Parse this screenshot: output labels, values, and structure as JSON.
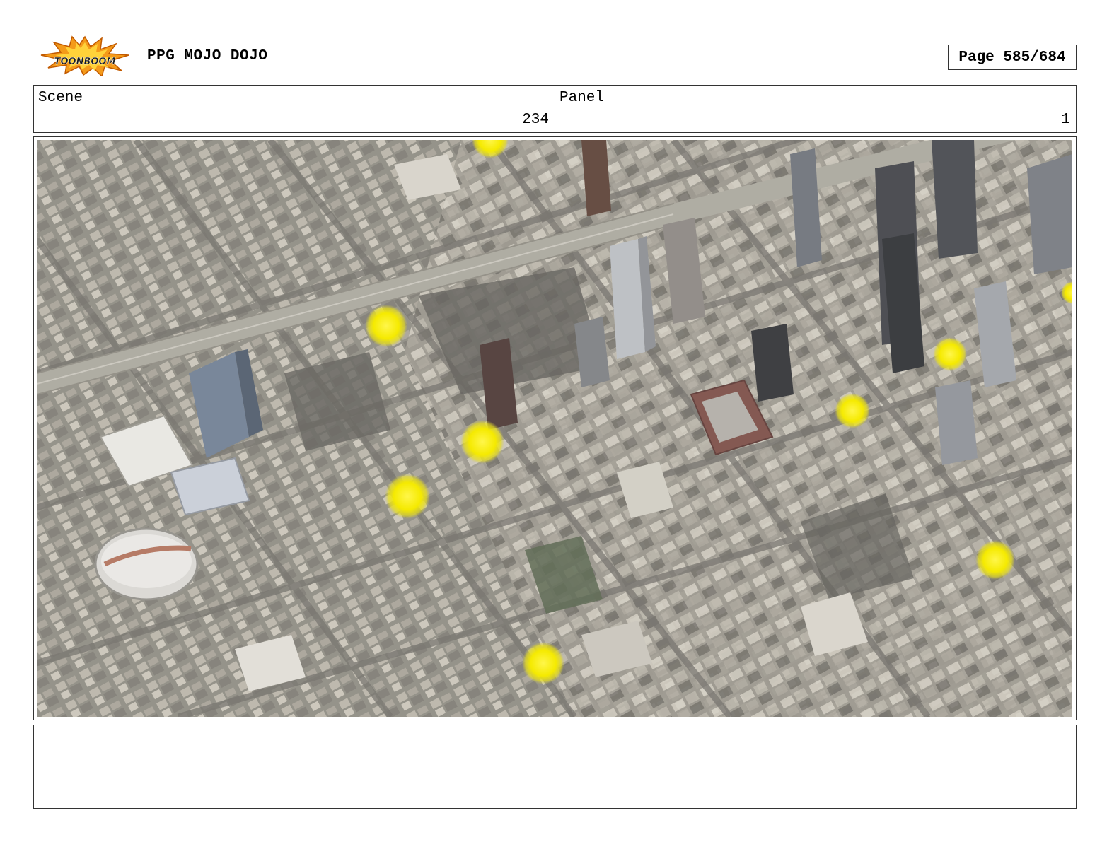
{
  "header": {
    "logo": {
      "text": "TOONBOOM",
      "icon": "toonboom-starburst-logo"
    },
    "project_title": "PPG MOJO DOJO",
    "page_label": "Page 585/684"
  },
  "info": {
    "scene_label": "Scene",
    "scene_value": "234",
    "panel_label": "Panel",
    "panel_value": "1"
  },
  "panel": {
    "image_description_icon": "aerial-city-map-image",
    "marker_color": "#f5ea00",
    "marker_count": 9
  },
  "notes": {
    "text": ""
  }
}
